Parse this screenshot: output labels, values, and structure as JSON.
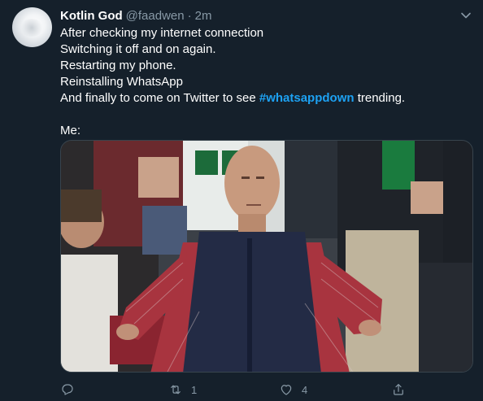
{
  "tweet": {
    "author": {
      "name": "Kotlin God",
      "handle": "@faadwen",
      "separator": "·",
      "time": "2m"
    },
    "lines": [
      "After checking my internet connection",
      "Switching it off and on again.",
      "Restarting my phone.",
      "Reinstalling WhatsApp"
    ],
    "last_line_prefix": "And finally to come on Twitter to see ",
    "hashtag": "#whatsappdown",
    "last_line_suffix": " trending.",
    "me_line": "Me:",
    "media_icon": "meme-photo-disappointed-fan",
    "actions": {
      "reply": {
        "icon": "reply-icon",
        "count": ""
      },
      "retweet": {
        "icon": "retweet-icon",
        "count": "1"
      },
      "like": {
        "icon": "heart-icon",
        "count": "4"
      },
      "share": {
        "icon": "share-icon",
        "count": ""
      }
    }
  },
  "colors": {
    "background": "#15202b",
    "text": "#ffffff",
    "secondary": "#8899a6",
    "accent": "#1da1f2"
  }
}
